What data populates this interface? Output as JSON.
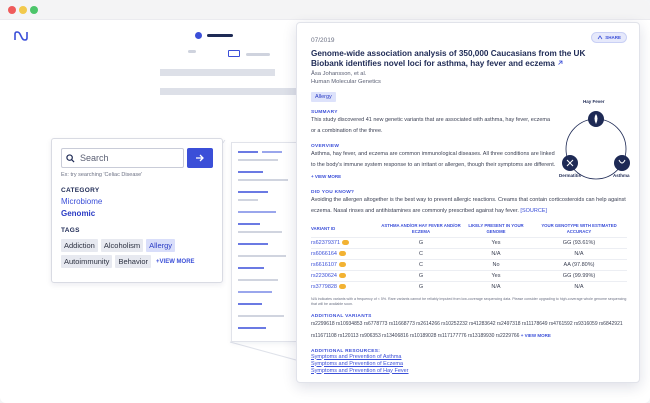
{
  "search": {
    "placeholder": "Search",
    "hint": "Ex: try searching 'Celiac Disease'",
    "category_header": "CATEGORY",
    "categories": [
      "Microbiome",
      "Genomic"
    ],
    "tags_header": "TAGS",
    "tags": [
      "Addiction",
      "Alcoholism",
      "Allergy",
      "Autoimmunity",
      "Behavior"
    ],
    "view_more": "+VIEW MORE"
  },
  "article": {
    "date": "07/2019",
    "share": "SHARE",
    "title": "Genome-wide association analysis of 350,000 Caucasians from the UK Biobank identifies novel loci for asthma, hay fever and eczema",
    "authors": "Åsa Johansson, et al.",
    "journal": "Human Molecular Genetics",
    "badge": "Allergy",
    "summary_header": "SUMMARY",
    "summary": "This study discovered 41 new genetic variants that are associated with asthma, hay fever, eczema or a combination of the three.",
    "overview_header": "OVERVIEW",
    "overview": "Asthma, hay fever, and eczema are common immunological diseases. All three conditions are linked to the body's immune system response to an irritant or allergen, though their symptoms are different.",
    "overview_more": "+ VIEW MORE",
    "dyk_header": "DID YOU KNOW?",
    "dyk": "Avoiding the allergen altogether is the best way to prevent allergic reactions. Creams that contain corticosteroids can help against eczema. Nasal rinses and antihistamines are commonly prescribed against hay fever.",
    "dyk_ref": "[SOURCE]",
    "venn": {
      "top": "Hay Fever",
      "left": "Dermatitis",
      "right": "Asthma"
    },
    "table": {
      "headers": [
        "VARIANT ID",
        "ASTHMA AND/OR HAY FEVER AND/OR ECZEMA",
        "LIKELY PRESENT IN YOUR GENOME",
        "YOUR GENOTYPE WITH ESTIMATED ACCURACY"
      ],
      "rows": [
        [
          "rs62379371",
          "G",
          "Yes",
          "GG (93.61%)"
        ],
        [
          "rs6066164",
          "C",
          "N/A",
          "N/A"
        ],
        [
          "rs6616107",
          "C",
          "No",
          "AA (97.80%)"
        ],
        [
          "rs2230624",
          "G",
          "Yes",
          "GG (99.99%)"
        ],
        [
          "rs3779828",
          "G",
          "N/A",
          "N/A"
        ]
      ]
    },
    "note": "N/A indicates variants with a frequency of < 5%. Rare variants cannot be reliably imputed from low-coverage sequencing data. Please consider upgrading to high-coverage whole genome sequencing that will be available soon.",
    "additional_header": "ADDITIONAL VARIANTS",
    "additional": "rs2299618 rs10934853 rs6778773 rs11668773 rs2614266 rs10252232 rs41283642 rs2497318 rs11178649 rs4761592 rs9316059 rs6842921 rs11671108 rs120113 rs906353 rs13406816 rs10189028 rs117177776 rs13189930 rs2229766",
    "additional_more": "+ VIEW MORE",
    "resources_header": "ADDITIONAL RESOURCES:",
    "resources": [
      "Symptoms and Prevention of Asthma",
      "Symptoms and Prevention of Eczema",
      "Symptoms and Prevention of Hay Fever"
    ]
  },
  "colors": {
    "accent": "#3b4fd8",
    "navy": "#1e2a55",
    "badge": "#f2b233"
  }
}
